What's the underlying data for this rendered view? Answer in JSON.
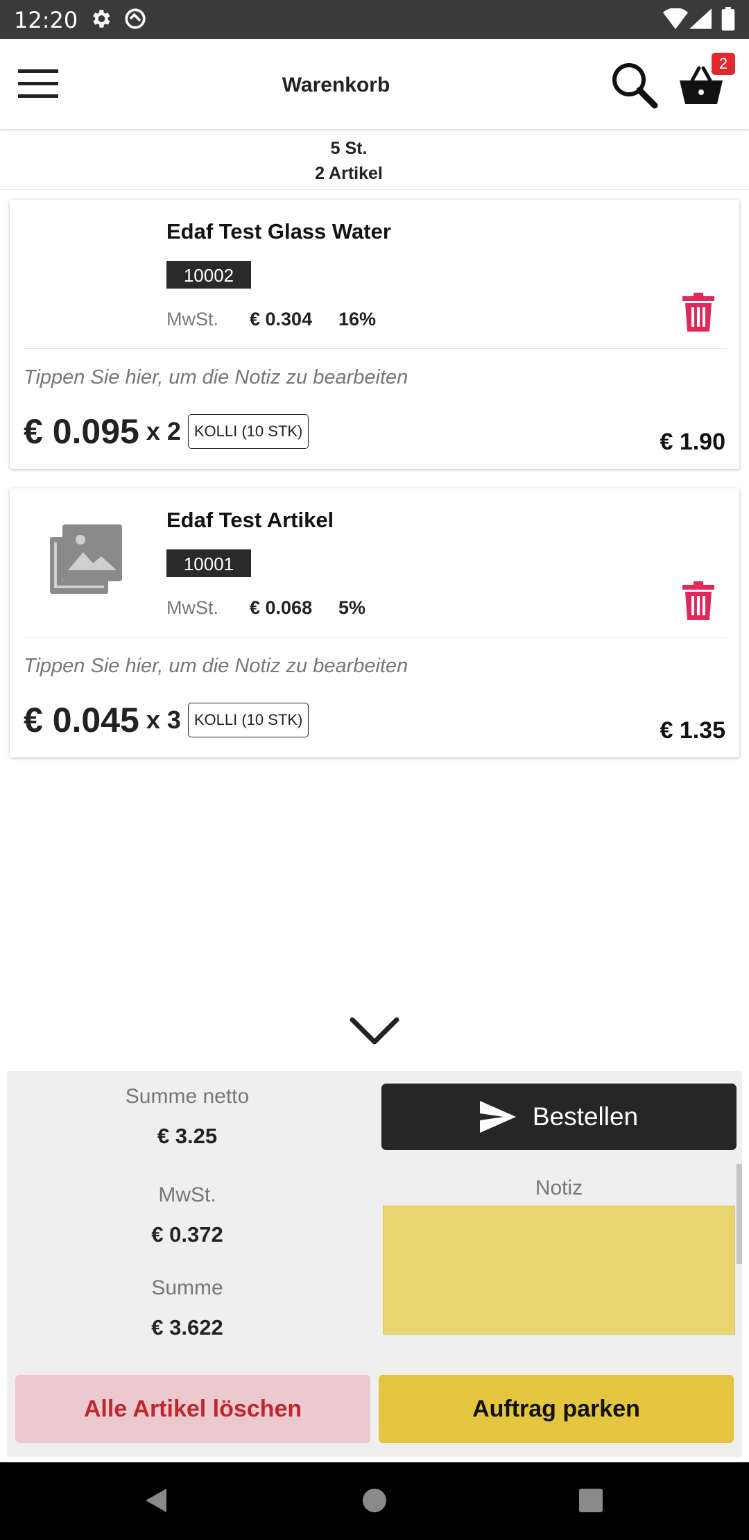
{
  "status_bar": {
    "time": "12:20",
    "icons": [
      "gear-icon",
      "data-saver-icon",
      "wifi-icon",
      "signal-icon",
      "battery-icon"
    ]
  },
  "app_bar": {
    "title": "Warenkorb",
    "icons": [
      "menu-icon",
      "search-icon",
      "basket-icon"
    ],
    "cart_badge": "2"
  },
  "summary": {
    "quantity": "5 St.",
    "article_count": "2 Artikel"
  },
  "items": [
    {
      "name": "Edaf Test Glass Water",
      "sku": "10002",
      "vat_label": "MwSt.",
      "vat_amount": "€ 0.304",
      "vat_rate": "16%",
      "note_placeholder": "Tippen Sie hier, um die Notiz zu bearbeiten",
      "unit_price": "€ 0.095",
      "quantity": "x 2",
      "unit": "KOLLI (10 STK)",
      "line_total": "€ 1.90",
      "has_image": false
    },
    {
      "name": "Edaf Test Artikel",
      "sku": "10001",
      "vat_label": "MwSt.",
      "vat_amount": "€ 0.068",
      "vat_rate": "5%",
      "note_placeholder": "Tippen Sie hier, um die Notiz zu bearbeiten",
      "unit_price": "€ 0.045",
      "quantity": "x 3",
      "unit": "KOLLI (10 STK)",
      "line_total": "€ 1.35",
      "has_image": true
    }
  ],
  "totals": {
    "net_label": "Summe netto",
    "net_value": "€ 3.25",
    "vat_label": "MwSt.",
    "vat_value": "€ 0.372",
    "total_label": "Summe",
    "total_value": "€ 3.622"
  },
  "actions": {
    "order_label": "Bestellen",
    "note_label": "Notiz",
    "note_value": "",
    "delete_all_label": "Alle Artikel löschen",
    "park_label": "Auftrag parken"
  },
  "colors": {
    "danger": "#e0285a",
    "note_yellow": "#e9d56f",
    "park_yellow": "#e3c540",
    "delete_pink": "#ecc9cf",
    "delete_text": "#c0262e",
    "dark": "#262626"
  }
}
